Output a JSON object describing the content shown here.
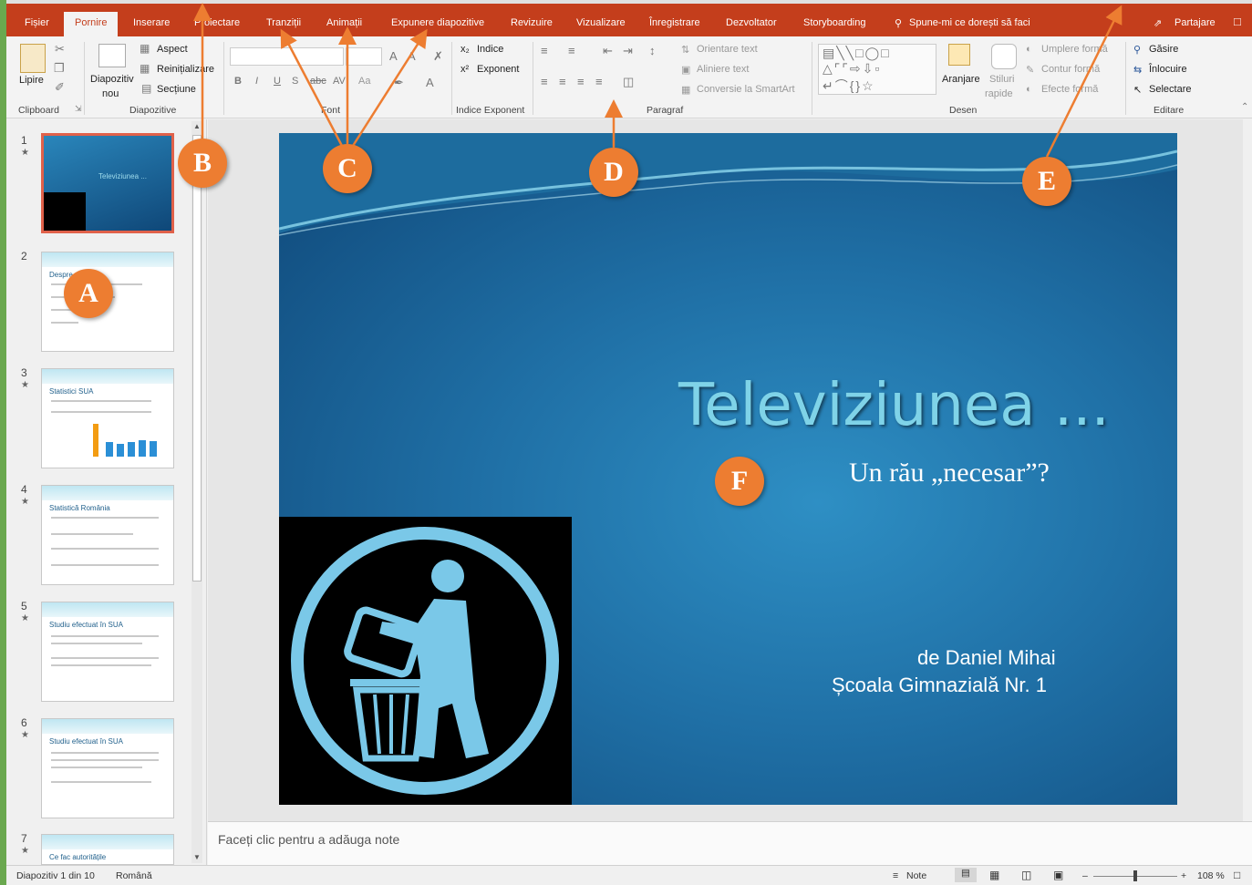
{
  "tabs": [
    "Fișier",
    "Pornire",
    "Inserare",
    "Proiectare",
    "Tranziții",
    "Animații",
    "Expunere diapozitive",
    "Revizuire",
    "Vizualizare",
    "Înregistrare",
    "Dezvoltator",
    "Storyboarding"
  ],
  "tell_me": "Spune-mi ce dorești să faci",
  "share": "Partajare",
  "ribbon": {
    "clipboard": {
      "paste": "Lipire",
      "label": "Clipboard"
    },
    "slides": {
      "new_slide_1": "Diapozitiv",
      "new_slide_2": "nou",
      "layout": "Aspect",
      "reset": "Reinițializare",
      "section": "Secțiune",
      "label": "Diapozitive"
    },
    "font": {
      "font_size": "Aa",
      "label": "Font"
    },
    "index": {
      "subscript": "Indice",
      "superscript": "Exponent",
      "label": "Indice Exponent"
    },
    "paragraph": {
      "text_direction": "Orientare text",
      "align_text": "Aliniere text",
      "smartart": "Conversie la SmartArt",
      "label": "Paragraf"
    },
    "drawing": {
      "arrange": "Aranjare",
      "styles_1": "Stiluri",
      "styles_2": "rapide",
      "fill": "Umplere formă",
      "outline": "Contur formă",
      "effects": "Efecte formă",
      "label": "Desen"
    },
    "editing": {
      "find": "Găsire",
      "replace": "Înlocuire",
      "select": "Selectare",
      "label": "Editare"
    }
  },
  "slides": [
    {
      "num": "1",
      "title": "Televiziunea ..."
    },
    {
      "num": "2",
      "title": "Despre ... orbi"
    },
    {
      "num": "3",
      "title": "Statistici SUA"
    },
    {
      "num": "4",
      "title": "Statistică România"
    },
    {
      "num": "5",
      "title": "Studiu efectuat în SUA"
    },
    {
      "num": "6",
      "title": "Studiu efectuat în SUA"
    },
    {
      "num": "7",
      "title": "Ce fac autoritățile"
    }
  ],
  "slide": {
    "title": "Televiziunea ...",
    "subtitle": "Un rău „necesar”?",
    "author": "de Daniel Mihai",
    "school": "Școala Gimnazială Nr. 1"
  },
  "notes_placeholder": "Faceți clic pentru a adăuga note",
  "status": {
    "slide_count": "Diapozitiv 1 din 10",
    "language": "Română",
    "notes": "Note",
    "zoom": "108 %"
  },
  "callouts": [
    "A",
    "B",
    "C",
    "D",
    "E",
    "F"
  ],
  "colors": {
    "accent": "#c43e1c",
    "callout": "#ed7d31"
  }
}
